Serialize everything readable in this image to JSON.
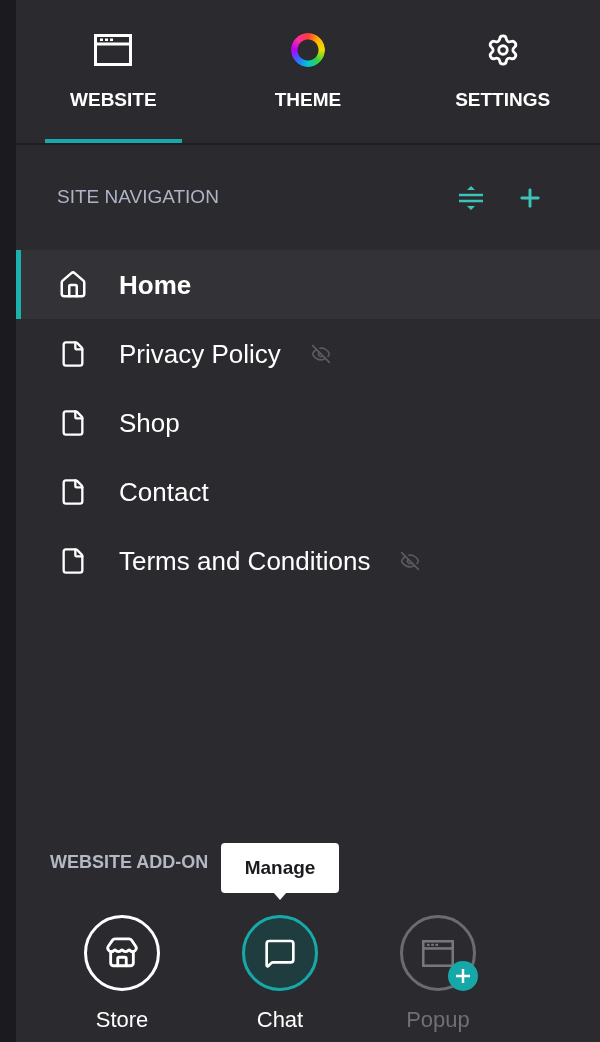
{
  "tabs": [
    {
      "label": "WEBSITE",
      "selected": true
    },
    {
      "label": "THEME",
      "selected": false
    },
    {
      "label": "SETTINGS",
      "selected": false
    }
  ],
  "site_navigation": {
    "title": "SITE NAVIGATION",
    "items": [
      {
        "kind": "home",
        "label": "Home",
        "selected": true,
        "hidden": false
      },
      {
        "kind": "page",
        "label": "Privacy Policy",
        "selected": false,
        "hidden": true
      },
      {
        "kind": "page",
        "label": "Shop",
        "selected": false,
        "hidden": false
      },
      {
        "kind": "page",
        "label": "Contact",
        "selected": false,
        "hidden": false
      },
      {
        "kind": "page",
        "label": "Terms and Conditions",
        "selected": false,
        "hidden": true
      }
    ]
  },
  "add_ons": {
    "title": "WEBSITE ADD-ON",
    "items": [
      {
        "label": "Store",
        "installed": true,
        "selected": false
      },
      {
        "label": "Chat",
        "installed": true,
        "selected": true,
        "tooltip": "Manage"
      },
      {
        "label": "Popup",
        "installed": false,
        "selected": false
      }
    ]
  }
}
